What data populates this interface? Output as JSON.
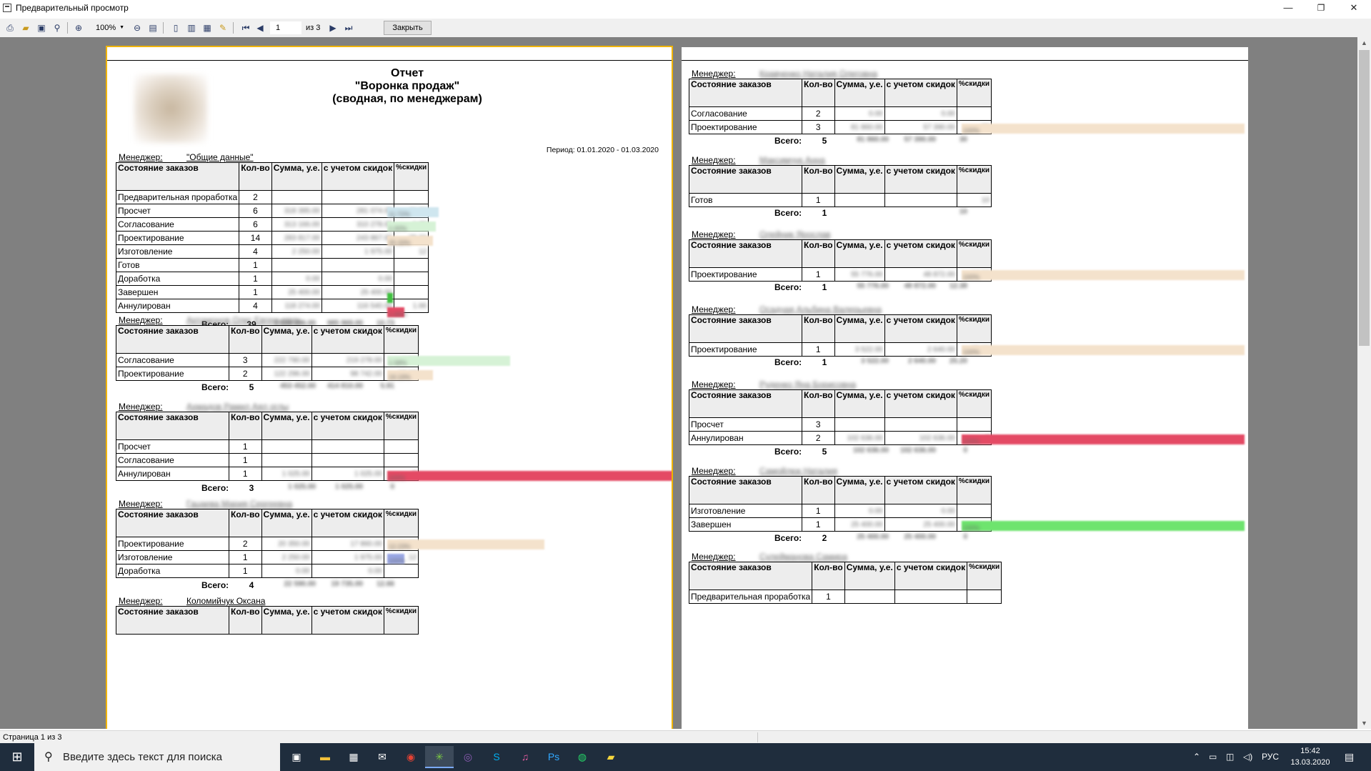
{
  "window": {
    "title": "Предварительный просмотр",
    "minimize": "—",
    "maximize": "❐",
    "close": "✕"
  },
  "toolbar": {
    "zoom": "100%",
    "page_current": "1",
    "page_of": "из 3",
    "close_label": "Закрыть",
    "icons": [
      "print-icon",
      "open-icon",
      "save-icon",
      "find-icon",
      "zoom-in-icon",
      "zoom-out-icon",
      "fit-page-icon",
      "single-page-icon",
      "multi-page-icon",
      "page-setup-icon",
      "edit-icon",
      "first-page-icon",
      "prev-page-icon",
      "next-page-icon",
      "last-page-icon"
    ]
  },
  "report": {
    "title_line1": "Отчет",
    "title_line2": "\"Воронка продаж\"",
    "title_line3": "(сводная, по менеджерам)",
    "period": "Период: 01.01.2020 - 01.03.2020",
    "manager_label": "Менеджер:",
    "total_label": "Всего:",
    "headers": {
      "state": "Состояние заказов",
      "qty": "Кол-во",
      "sum": "Сумма, у.е.",
      "with_discount": "с учетом скидок",
      "discount_pct": "%скидки"
    }
  },
  "page1": {
    "sections": [
      {
        "manager": "\"Общие данные\"",
        "manager_blurred": false,
        "rows": [
          {
            "state": "Предварительная проработка",
            "qty": "2",
            "sum": "",
            "disc": "",
            "pct": ""
          },
          {
            "state": "Просчет",
            "qty": "6",
            "sum": "318 395.00",
            "disc": "281 074.00",
            "pct": "11.72"
          },
          {
            "state": "Согласование",
            "qty": "6",
            "sum": "313 166.00",
            "disc": "310 278.00",
            "pct": "1.00"
          },
          {
            "state": "Проектирование",
            "qty": "14",
            "sum": "283 817.00",
            "disc": "243 867.00",
            "pct": "25.33"
          },
          {
            "state": "Изготовление",
            "qty": "4",
            "sum": "2 250.00",
            "disc": "1 975.00",
            "pct": "12"
          },
          {
            "state": "Готов",
            "qty": "1",
            "sum": "",
            "disc": "",
            "pct": ""
          },
          {
            "state": "Доработка",
            "qty": "1",
            "sum": "0.00",
            "disc": "0.00",
            "pct": ""
          },
          {
            "state": "Завершен",
            "qty": "1",
            "sum": "25 400.00",
            "disc": "25 400.00",
            "pct": ""
          },
          {
            "state": "Аннулирован",
            "qty": "4",
            "sum": "118 274.00",
            "disc": "116 540.00",
            "pct": "1.66"
          }
        ],
        "total_qty": "39",
        "total_sum": "1 104 496.00",
        "total_disc": "985 969.00",
        "total_pct": "10.73"
      },
      {
        "manager": "Артамонов Олег Евгеньевич",
        "manager_blurred": true,
        "rows": [
          {
            "state": "Согласование",
            "qty": "3",
            "sum": "222 790.00",
            "disc": "219 278.00",
            "pct": "1.58"
          },
          {
            "state": "Проектирование",
            "qty": "2",
            "sum": "122 296.00",
            "disc": "98 742.00",
            "pct": "19.19"
          }
        ],
        "total_qty": "5",
        "total_sum": "453 452.00",
        "total_disc": "414 810.00",
        "total_pct": "5.91"
      },
      {
        "manager": "Ахмадов Рамил Аял оглы",
        "manager_blurred": true,
        "rows": [
          {
            "state": "Просчет",
            "qty": "1",
            "sum": "",
            "disc": "",
            "pct": ""
          },
          {
            "state": "Согласование",
            "qty": "1",
            "sum": "",
            "disc": "",
            "pct": ""
          },
          {
            "state": "Аннулирован",
            "qty": "1",
            "sum": "1 025.00",
            "disc": "1 025.00",
            "pct": "0"
          }
        ],
        "total_qty": "3",
        "total_sum": "1 025.00",
        "total_disc": "1 025.00",
        "total_pct": "0"
      },
      {
        "manager": "Гацаева Мария Сергеевна",
        "manager_blurred": true,
        "rows": [
          {
            "state": "Проектирование",
            "qty": "2",
            "sum": "20 350.00",
            "disc": "17 860.00",
            "pct": "12.23"
          },
          {
            "state": "Изготовление",
            "qty": "1",
            "sum": "2 250.00",
            "disc": "1 975.00",
            "pct": "12"
          },
          {
            "state": "Доработка",
            "qty": "1",
            "sum": "0.00",
            "disc": "0.00",
            "pct": ""
          }
        ],
        "total_qty": "4",
        "total_sum": "22 590.00",
        "total_disc": "19 735.00",
        "total_pct": "12.66"
      },
      {
        "manager": "Коломийчук Оксана",
        "manager_blurred": false,
        "rows": [],
        "total_qty": "",
        "total_sum": "",
        "total_disc": "",
        "total_pct": ""
      }
    ]
  },
  "page2": {
    "sections": [
      {
        "manager": "Кравченко Наталия Олеговна",
        "rows": [
          {
            "state": "Согласование",
            "qty": "2",
            "sum": "0.00",
            "disc": "0.00",
            "pct": ""
          },
          {
            "state": "Проектирование",
            "qty": "3",
            "sum": "81 860.00",
            "disc": "57 390.00",
            "pct": "30"
          }
        ],
        "total_qty": "5",
        "total_sum": "81 860.00",
        "total_disc": "57 390.00",
        "total_pct": "30"
      },
      {
        "manager": "Максимчук Анна",
        "rows": [
          {
            "state": "Готов",
            "qty": "1",
            "sum": "",
            "disc": "",
            "pct": "10"
          }
        ],
        "total_qty": "1",
        "total_sum": "",
        "total_disc": "",
        "total_pct": "10"
      },
      {
        "manager": "Олейник Ярослав",
        "rows": [
          {
            "state": "Проектирование",
            "qty": "1",
            "sum": "55 776.00",
            "disc": "48 872.00",
            "pct": "12.38"
          }
        ],
        "total_qty": "1",
        "total_sum": "55 776.00",
        "total_disc": "48 872.00",
        "total_pct": "12.38"
      },
      {
        "manager": "Осадчая Альбина Валерьевна",
        "rows": [
          {
            "state": "Проектирование",
            "qty": "1",
            "sum": "3 522.00",
            "disc": "2 640.00",
            "pct": "25.20"
          }
        ],
        "total_qty": "1",
        "total_sum": "3 522.00",
        "total_disc": "2 640.00",
        "total_pct": "25.20"
      },
      {
        "manager": "Руденко Яна Борисовна",
        "rows": [
          {
            "state": "Просчет",
            "qty": "3",
            "sum": "",
            "disc": "",
            "pct": ""
          },
          {
            "state": "Аннулирован",
            "qty": "2",
            "sum": "102 636.00",
            "disc": "102 636.00",
            "pct": "0"
          }
        ],
        "total_qty": "5",
        "total_sum": "102 636.00",
        "total_disc": "102 636.00",
        "total_pct": "0"
      },
      {
        "manager": "Самойлюк Наталия",
        "rows": [
          {
            "state": "Изготовление",
            "qty": "1",
            "sum": "0.00",
            "disc": "0.00",
            "pct": ""
          },
          {
            "state": "Завершен",
            "qty": "1",
            "sum": "25 400.00",
            "disc": "25 400.00",
            "pct": ""
          }
        ],
        "total_qty": "2",
        "total_sum": "25 400.00",
        "total_disc": "25 400.00",
        "total_pct": "0"
      },
      {
        "manager": "Сулейманова Самира",
        "rows": [
          {
            "state": "Предварительная проработка",
            "qty": "1",
            "sum": "",
            "disc": "",
            "pct": ""
          }
        ],
        "total_qty": "",
        "total_sum": "",
        "total_disc": "",
        "total_pct": ""
      }
    ]
  },
  "bars": {
    "colors": {
      "peach": "#f4e2cc",
      "light_blue": "#cfe6ef",
      "light_green": "#d6f2d6",
      "red": "#e44a64",
      "green": "#6ee46e",
      "blue": "#9ba8e6",
      "dark_green": "#3fbf3f"
    },
    "page1": [
      {
        "row": "0-1",
        "color": "light_blue",
        "level": 0.18,
        "label": "11.72%"
      },
      {
        "row": "0-2",
        "color": "light_green",
        "level": 0.17,
        "label": "1.00%"
      },
      {
        "row": "0-3",
        "color": "peach",
        "level": 0.16,
        "label": "25.33%"
      },
      {
        "row": "0-7",
        "color": "dark_green",
        "level": 0.02,
        "label": ""
      },
      {
        "row": "0-8",
        "color": "red",
        "level": 0.06,
        "label": "1.66%"
      },
      {
        "row": "1-0",
        "color": "light_green",
        "level": 0.43,
        "label": "1.58%"
      },
      {
        "row": "1-1",
        "color": "peach",
        "level": 0.16,
        "label": "19.19%"
      },
      {
        "row": "2-2",
        "color": "red",
        "level": 1.0,
        "label": "100%"
      },
      {
        "row": "3-0",
        "color": "peach",
        "level": 0.55,
        "label": "12.23%"
      },
      {
        "row": "3-1",
        "color": "blue",
        "level": 0.06,
        "label": "100%"
      }
    ],
    "page2": [
      {
        "row": "0-1",
        "color": "peach",
        "level": 1.0,
        "label": "100%"
      },
      {
        "row": "2-0",
        "color": "peach",
        "level": 1.0,
        "label": "100%"
      },
      {
        "row": "3-0",
        "color": "peach",
        "level": 1.0,
        "label": "100%"
      },
      {
        "row": "4-1",
        "color": "red",
        "level": 1.0,
        "label": "100%"
      },
      {
        "row": "5-1",
        "color": "green",
        "level": 1.0,
        "label": "100%"
      }
    ]
  },
  "statusbar": {
    "text": "Страница 1 из 3"
  },
  "taskbar": {
    "search_placeholder": "Введите здесь текст для поиска",
    "apps": [
      "task-view-icon",
      "file-explorer-icon",
      "store-icon",
      "mail-icon",
      "chrome-icon",
      "joomla-icon",
      "viber-icon",
      "skype-icon",
      "itunes-icon",
      "photoshop-icon",
      "whatsapp-icon",
      "notes-icon"
    ],
    "lang": "РУС",
    "time": "15:42",
    "date": "13.03.2020"
  }
}
